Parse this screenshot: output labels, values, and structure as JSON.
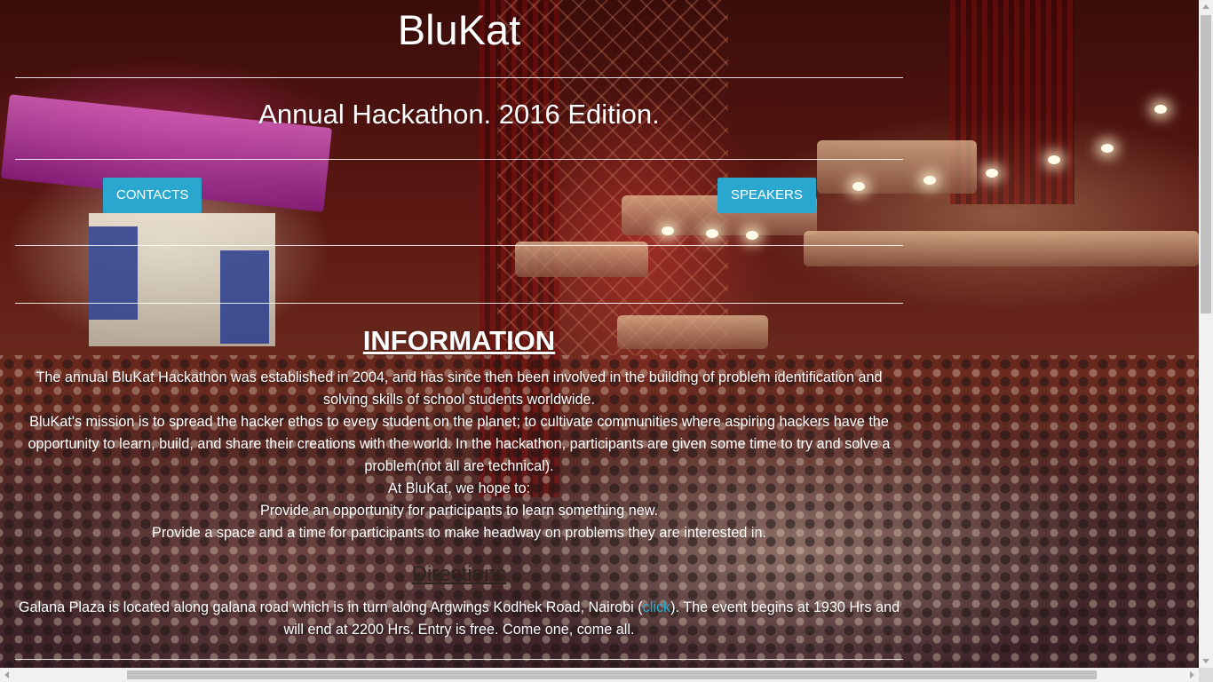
{
  "page": {
    "title": "BluKat",
    "subtitle": "Annual Hackathon. 2016 Edition."
  },
  "nav": {
    "contacts_label": "CONTACTS",
    "speakers_label": "SPEAKERS",
    "button_color": "#2aa7cf"
  },
  "information": {
    "heading": "INFORMATION",
    "lines": [
      "The annual BluKat Hackathon was established in 2004, and has since then been involved in the building of problem identification and solving skills of school students worldwide.",
      "BluKat's mission is to spread the hacker ethos to every student on the planet; to cultivate communities where aspiring hackers have the opportunity to learn, build, and share their creations with the world. In the hackathon, participants are given some time to try and solve a problem(not all are technical).",
      "At BluKat, we hope to:",
      "Provide an opportunity for participants to learn something new.",
      "Provide a space and a time for participants to make headway on problems they are interested in."
    ]
  },
  "directions": {
    "heading": "Directions",
    "text_before": "Galana Plaza is located along galana road which is in turn along Argwings Kodhek Road, Nairobi (",
    "link_label": "click",
    "text_after": "). The event begins at 1930 Hrs and will end at 2200 Hrs. Entry is free. Come one, come all.",
    "link_color": "#22b5d9"
  }
}
